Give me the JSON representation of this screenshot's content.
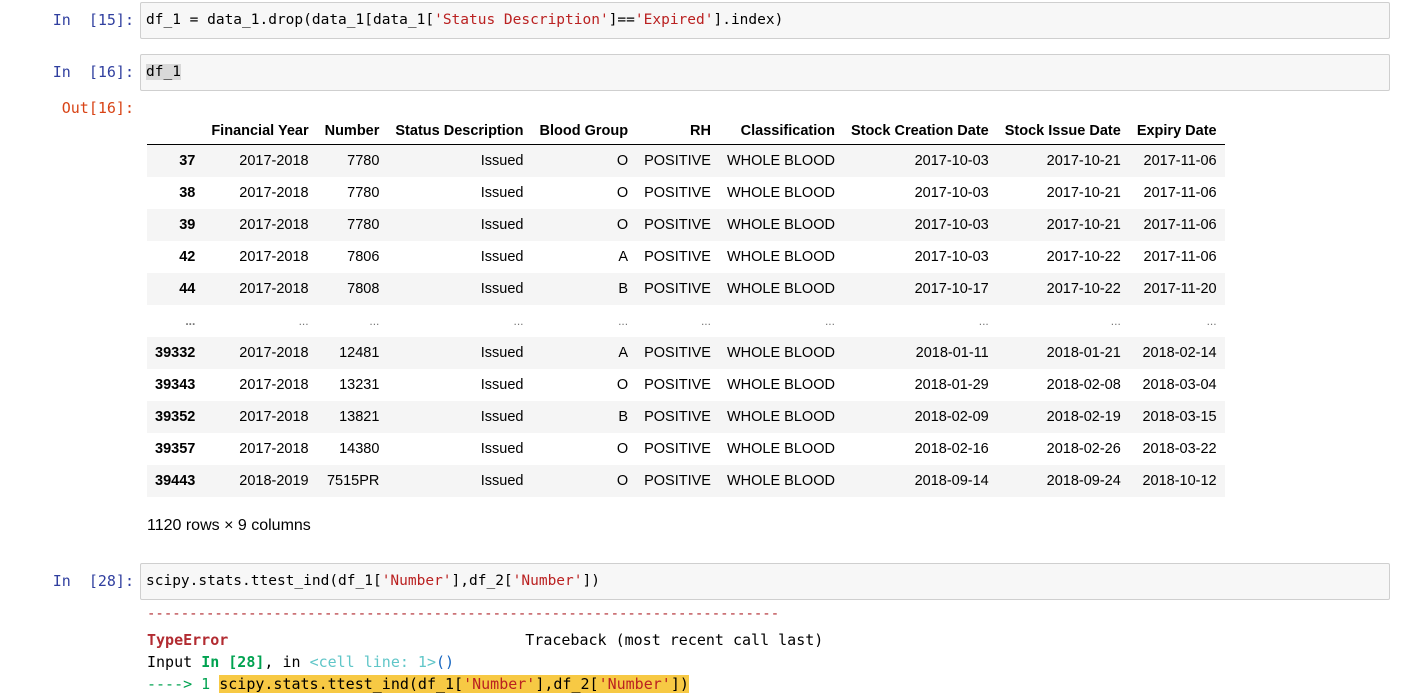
{
  "cells": [
    {
      "prompt": "In  [15]:",
      "code": {
        "pre": "df_1 = data_1.drop(data_1[data_1[",
        "s1": "'Status Description'",
        "mid": "]==",
        "s2": "'Expired'",
        "post": "].index)"
      }
    },
    {
      "prompt": "In  [16]:",
      "code": {
        "sel": "df_1"
      }
    },
    {
      "out_prompt": "Out[16]:"
    },
    {
      "prompt": "In  [28]:",
      "code": {
        "pre": "scipy.stats.ttest_ind(df_1[",
        "s1": "'Number'",
        "mid": "],df_2[",
        "s2": "'Number'",
        "post": "])"
      }
    }
  ],
  "dataframe": {
    "columns": [
      "",
      "Financial Year",
      "Number",
      "Status Description",
      "Blood Group",
      "RH",
      "Classification",
      "Stock Creation Date",
      "Stock Issue Date",
      "Expiry Date"
    ],
    "rows": [
      [
        "37",
        "2017-2018",
        "7780",
        "Issued",
        "O",
        "POSITIVE",
        "WHOLE BLOOD",
        "2017-10-03",
        "2017-10-21",
        "2017-11-06"
      ],
      [
        "38",
        "2017-2018",
        "7780",
        "Issued",
        "O",
        "POSITIVE",
        "WHOLE BLOOD",
        "2017-10-03",
        "2017-10-21",
        "2017-11-06"
      ],
      [
        "39",
        "2017-2018",
        "7780",
        "Issued",
        "O",
        "POSITIVE",
        "WHOLE BLOOD",
        "2017-10-03",
        "2017-10-21",
        "2017-11-06"
      ],
      [
        "42",
        "2017-2018",
        "7806",
        "Issued",
        "A",
        "POSITIVE",
        "WHOLE BLOOD",
        "2017-10-03",
        "2017-10-22",
        "2017-11-06"
      ],
      [
        "44",
        "2017-2018",
        "7808",
        "Issued",
        "B",
        "POSITIVE",
        "WHOLE BLOOD",
        "2017-10-17",
        "2017-10-22",
        "2017-11-20"
      ],
      [
        "...",
        "...",
        "...",
        "...",
        "...",
        "...",
        "...",
        "...",
        "...",
        "..."
      ],
      [
        "39332",
        "2017-2018",
        "12481",
        "Issued",
        "A",
        "POSITIVE",
        "WHOLE BLOOD",
        "2018-01-11",
        "2018-01-21",
        "2018-02-14"
      ],
      [
        "39343",
        "2017-2018",
        "13231",
        "Issued",
        "O",
        "POSITIVE",
        "WHOLE BLOOD",
        "2018-01-29",
        "2018-02-08",
        "2018-03-04"
      ],
      [
        "39352",
        "2017-2018",
        "13821",
        "Issued",
        "B",
        "POSITIVE",
        "WHOLE BLOOD",
        "2018-02-09",
        "2018-02-19",
        "2018-03-15"
      ],
      [
        "39357",
        "2017-2018",
        "14380",
        "Issued",
        "O",
        "POSITIVE",
        "WHOLE BLOOD",
        "2018-02-16",
        "2018-02-26",
        "2018-03-22"
      ],
      [
        "39443",
        "2018-2019",
        "7515PR",
        "Issued",
        "O",
        "POSITIVE",
        "WHOLE BLOOD",
        "2018-09-14",
        "2018-09-24",
        "2018-10-12"
      ]
    ],
    "shape": "1120 rows × 9 columns"
  },
  "traceback": {
    "dashes": "---------------------------------------------------------------------------",
    "error_name": "TypeError",
    "header_right": "Traceback (most recent call last)",
    "input_label": "Input ",
    "input_ref": "In [28]",
    "in_sep": ", in ",
    "cell_line": "<cell line: 1>",
    "cell_tail": "()",
    "arrow": "----> 1 ",
    "line_pre": "scipy.stats.ttest_ind(df_1[",
    "line_s1": "'Number'",
    "line_mid": "],df_2[",
    "line_s2": "'Number'",
    "line_post": "])"
  },
  "colors": {
    "prompt_in": "#303f9f",
    "prompt_out": "#d84315",
    "string": "#ba2121",
    "error": "#b22b31",
    "highlight": "#f7c944"
  }
}
